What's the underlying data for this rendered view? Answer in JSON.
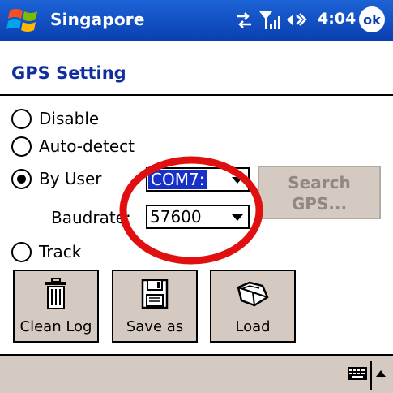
{
  "titlebar": {
    "app_title": "Singapore",
    "time": "4:04",
    "ok_label": "ok",
    "icons": [
      "windows-start-icon",
      "sync-icon",
      "signal-icon",
      "volume-icon"
    ]
  },
  "page": {
    "title": "GPS Setting"
  },
  "options": {
    "disable": "Disable",
    "auto_detect": "Auto-detect",
    "by_user": "By User",
    "track": "Track",
    "selected": "By User"
  },
  "port": {
    "value": "COM7:"
  },
  "baudrate": {
    "label": "Baudrate:",
    "value": "57600"
  },
  "search_button": {
    "line1": "Search",
    "line2": "GPS..."
  },
  "actions": {
    "clean_log": "Clean Log",
    "save_as": "Save as",
    "load": "Load"
  },
  "colors": {
    "titlebar": "#0b3fb0",
    "title_text": "#102f9e",
    "annotation": "#e01010",
    "button_face": "#d4cac1"
  }
}
